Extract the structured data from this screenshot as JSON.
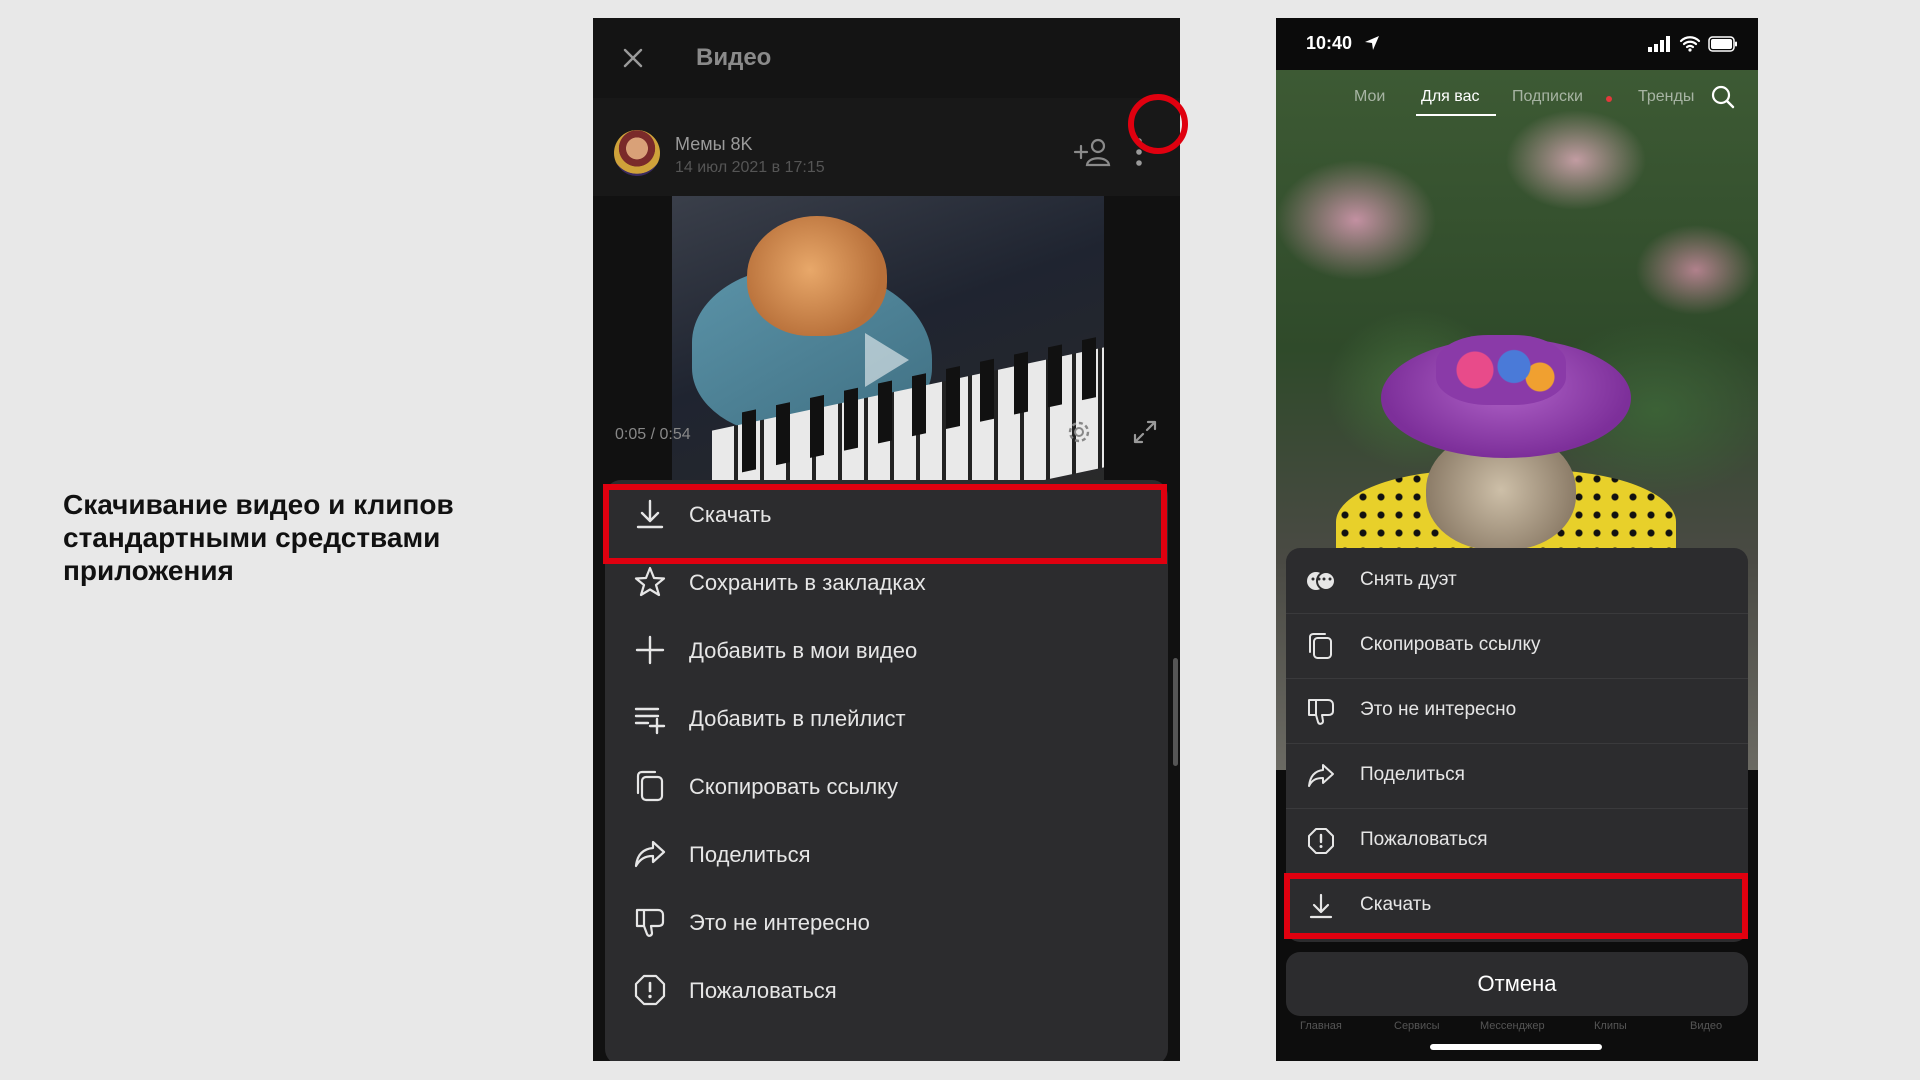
{
  "caption": "Скачивание видео и клипов\nстандартными средствами\nприложения",
  "left_phone": {
    "title": "Видео",
    "channel_name": "Мемы 8K",
    "date": "14 июл 2021 в 17:15",
    "time_display": "0:05 / 0:54",
    "menu": [
      {
        "label": "Скачать",
        "icon": "download-icon"
      },
      {
        "label": "Сохранить в закладках",
        "icon": "star-icon"
      },
      {
        "label": "Добавить в мои видео",
        "icon": "plus-icon"
      },
      {
        "label": "Добавить в плейлист",
        "icon": "playlist-add-icon"
      },
      {
        "label": "Скопировать ссылку",
        "icon": "copy-icon"
      },
      {
        "label": "Поделиться",
        "icon": "share-icon"
      },
      {
        "label": "Это не интересно",
        "icon": "dislike-icon"
      },
      {
        "label": "Пожаловаться",
        "icon": "report-icon"
      }
    ]
  },
  "right_phone": {
    "clock": "10:40",
    "tabs": [
      "Мои",
      "Для вас",
      "Подписки",
      "Тренды"
    ],
    "active_tab": "Для вас",
    "menu": [
      {
        "label": "Снять дуэт",
        "icon": "duet-icon"
      },
      {
        "label": "Скопировать ссылку",
        "icon": "copy-icon"
      },
      {
        "label": "Это не интересно",
        "icon": "dislike-icon"
      },
      {
        "label": "Поделиться",
        "icon": "share-icon"
      },
      {
        "label": "Пожаловаться",
        "icon": "report-icon"
      },
      {
        "label": "Скачать",
        "icon": "download-icon"
      }
    ],
    "cancel_label": "Отмена",
    "bottom_nav": [
      "Главная",
      "Сервисы",
      "Мессенджер",
      "Клипы",
      "Видео"
    ]
  },
  "colors": {
    "highlight": "#e0000f",
    "sheet_background": "#2c2c2e",
    "page_background": "#e8e8e8"
  }
}
